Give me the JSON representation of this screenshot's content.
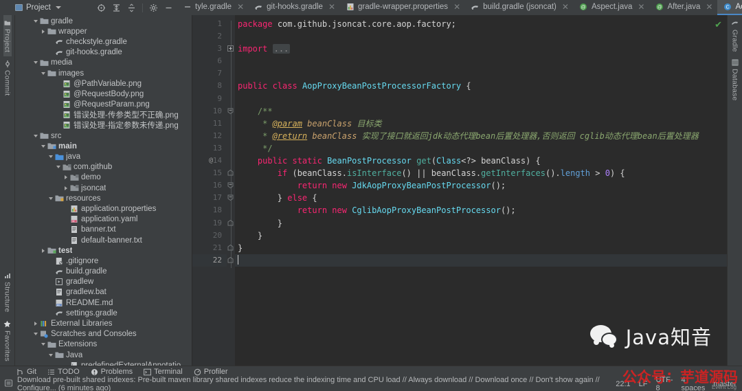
{
  "window": {
    "project_panel_title": "Project"
  },
  "project_toolbar": [
    {
      "name": "locate-file-icon",
      "title": "Select Opened File"
    },
    {
      "name": "expand-all-icon",
      "title": "Expand All"
    },
    {
      "name": "collapse-all-icon",
      "title": "Collapse All"
    },
    {
      "name": "settings-gear-icon",
      "title": "Options"
    },
    {
      "name": "hide-panel-icon",
      "title": "Hide"
    }
  ],
  "left_rail": {
    "top": [
      {
        "label": "Project",
        "icon": "project-icon",
        "selected": true
      },
      {
        "label": "Commit",
        "icon": "commit-icon",
        "selected": false
      }
    ],
    "bottom": [
      {
        "label": "Structure",
        "icon": "structure-icon"
      },
      {
        "label": "Favorites",
        "icon": "star-icon"
      }
    ]
  },
  "right_rail": [
    {
      "label": "Gradle",
      "icon": "gradle-icon"
    },
    {
      "label": "Database",
      "icon": "database-icon"
    }
  ],
  "tree": [
    {
      "label": "gradle",
      "indent": 2,
      "arrow": "down",
      "icon": "folder",
      "bold": false
    },
    {
      "label": "wrapper",
      "indent": 3,
      "arrow": "right",
      "icon": "folder",
      "bold": false
    },
    {
      "label": "checkstyle.gradle",
      "indent": 4,
      "arrow": "none",
      "icon": "gradle-file",
      "bold": false
    },
    {
      "label": "git-hooks.gradle",
      "indent": 4,
      "arrow": "none",
      "icon": "gradle-file",
      "bold": false
    },
    {
      "label": "media",
      "indent": 2,
      "arrow": "down",
      "icon": "folder",
      "bold": false
    },
    {
      "label": "images",
      "indent": 3,
      "arrow": "down",
      "icon": "folder",
      "bold": false
    },
    {
      "label": "@PathVariable.png",
      "indent": 5,
      "arrow": "none",
      "icon": "image-file",
      "bold": false
    },
    {
      "label": "@RequestBody.png",
      "indent": 5,
      "arrow": "none",
      "icon": "image-file",
      "bold": false
    },
    {
      "label": "@RequestParam.png",
      "indent": 5,
      "arrow": "none",
      "icon": "image-file",
      "bold": false
    },
    {
      "label": "错误处理-传参类型不正确.png",
      "indent": 5,
      "arrow": "none",
      "icon": "image-file",
      "bold": false
    },
    {
      "label": "错误处理-指定参数未传递.png",
      "indent": 5,
      "arrow": "none",
      "icon": "image-file",
      "bold": false
    },
    {
      "label": "src",
      "indent": 2,
      "arrow": "down",
      "icon": "folder",
      "bold": false
    },
    {
      "label": "main",
      "indent": 3,
      "arrow": "down",
      "icon": "source-root",
      "bold": true
    },
    {
      "label": "java",
      "indent": 4,
      "arrow": "down",
      "icon": "java-source-root",
      "bold": false
    },
    {
      "label": "com.github",
      "indent": 5,
      "arrow": "down",
      "icon": "package",
      "bold": false
    },
    {
      "label": "demo",
      "indent": 6,
      "arrow": "right",
      "icon": "package",
      "bold": false
    },
    {
      "label": "jsoncat",
      "indent": 6,
      "arrow": "right",
      "icon": "package",
      "bold": false
    },
    {
      "label": "resources",
      "indent": 4,
      "arrow": "down",
      "icon": "resource-root",
      "bold": false
    },
    {
      "label": "application.properties",
      "indent": 6,
      "arrow": "none",
      "icon": "properties-file",
      "bold": false
    },
    {
      "label": "application.yaml",
      "indent": 6,
      "arrow": "none",
      "icon": "yaml-file",
      "bold": false
    },
    {
      "label": "banner.txt",
      "indent": 6,
      "arrow": "none",
      "icon": "text-file",
      "bold": false
    },
    {
      "label": "default-banner.txt",
      "indent": 6,
      "arrow": "none",
      "icon": "text-file",
      "bold": false
    },
    {
      "label": "test",
      "indent": 3,
      "arrow": "right",
      "icon": "test-root",
      "bold": true
    },
    {
      "label": ".gitignore",
      "indent": 4,
      "arrow": "none",
      "icon": "ignore-file",
      "bold": false
    },
    {
      "label": "build.gradle",
      "indent": 4,
      "arrow": "none",
      "icon": "gradle-file",
      "bold": false
    },
    {
      "label": "gradlew",
      "indent": 4,
      "arrow": "none",
      "icon": "script-file",
      "bold": false
    },
    {
      "label": "gradlew.bat",
      "indent": 4,
      "arrow": "none",
      "icon": "text-file",
      "bold": false
    },
    {
      "label": "README.md",
      "indent": 4,
      "arrow": "none",
      "icon": "markdown-file",
      "bold": false
    },
    {
      "label": "settings.gradle",
      "indent": 4,
      "arrow": "none",
      "icon": "gradle-file",
      "bold": false
    },
    {
      "label": "External Libraries",
      "indent": 2,
      "arrow": "right",
      "icon": "libraries",
      "bold": false
    },
    {
      "label": "Scratches and Consoles",
      "indent": 2,
      "arrow": "down",
      "icon": "scratches",
      "bold": false
    },
    {
      "label": "Extensions",
      "indent": 3,
      "arrow": "down",
      "icon": "folder",
      "bold": false
    },
    {
      "label": "Java",
      "indent": 4,
      "arrow": "down",
      "icon": "folder",
      "bold": false
    },
    {
      "label": "predefinedExternalAnnotations.json",
      "indent": 6,
      "arrow": "none",
      "icon": "json-file",
      "bold": false
    }
  ],
  "tabs": [
    {
      "label": "tyle.gradle",
      "icon": "minus-icon",
      "active": false,
      "closable": true
    },
    {
      "label": "git-hooks.gradle",
      "icon": "gradle-file",
      "active": false,
      "closable": true
    },
    {
      "label": "gradle-wrapper.properties",
      "icon": "properties-file",
      "active": false,
      "closable": true
    },
    {
      "label": "build.gradle (jsoncat)",
      "icon": "gradle-file",
      "active": false,
      "closable": true
    },
    {
      "label": "Aspect.java",
      "icon": "annotation-green",
      "active": false,
      "closable": true
    },
    {
      "label": "After.java",
      "icon": "annotation-green",
      "active": false,
      "closable": true
    },
    {
      "label": "AopProxyBeanPostProcessorFactory.java",
      "icon": "class-blue",
      "active": true,
      "closable": true
    }
  ],
  "tabs_overflow_icon": "chevron-down-icon",
  "editor": {
    "line_numbers": [
      "1",
      "2",
      "3",
      "6",
      "7",
      "8",
      "9",
      "10",
      "11",
      "12",
      "13",
      "14",
      "15",
      "16",
      "17",
      "18",
      "19",
      "20",
      "21",
      "22"
    ],
    "gutter_annotation_line": "14",
    "gutter_annotation_mark": "@",
    "current_line": "22",
    "status_ok_icon": "checkmark-icon",
    "lines": [
      {
        "n": "1",
        "html": "<span class='kw'>package</span> <span class='pln'>com.github.jsoncat.core.aop.factory;</span>"
      },
      {
        "n": "2",
        "html": ""
      },
      {
        "n": "3",
        "html": "<span class='kw'>import</span> <span class='fold-ell'>...</span>"
      },
      {
        "n": "6",
        "html": ""
      },
      {
        "n": "7",
        "html": ""
      },
      {
        "n": "8",
        "html": "<span class='kw'>public class</span> <span class='cls'>AopProxyBeanPostProcessorFactory</span> <span class='pln'>{</span>"
      },
      {
        "n": "9",
        "html": ""
      },
      {
        "n": "10",
        "html": "    <span class='cm'>/**</span>"
      },
      {
        "n": "11",
        "html": "     <span class='cm'>* </span><span class='cmtag'>@param</span><span class='cm'> </span><span class='cmparam'>beanClass</span><span class='cm'> </span><span class='cmit'>目标类</span>"
      },
      {
        "n": "12",
        "html": "     <span class='cm'>* </span><span class='cmtag'>@return</span><span class='cm'> </span><span class='cmparam'>beanClass</span><span class='cm'> </span><span class='cmit'>实现了接口就返回jdk动态代理bean后置处理器,否则返回 cglib动态代理bean后置处理器</span>"
      },
      {
        "n": "13",
        "html": "     <span class='cm'>*/</span>"
      },
      {
        "n": "14",
        "html": "    <span class='kw'>public static</span> <span class='cls'>BeanPostProcessor</span> <span class='mth'>get</span><span class='pln'>(</span><span class='cls'>Class</span><span class='pln'>&lt;?&gt; beanClass) {</span>"
      },
      {
        "n": "15",
        "html": "        <span class='kw'>if</span> <span class='pln'>(beanClass.</span><span class='mth'>isInterface</span><span class='pln'>() || beanClass.</span><span class='mth'>getInterfaces</span><span class='pln'>().</span><span class='fld'>length</span><span class='pln'> &gt; </span><span class='num'>0</span><span class='pln'>) {</span>"
      },
      {
        "n": "16",
        "html": "            <span class='kw'>return new</span> <span class='cls'>JdkAopProxyBeanPostProcessor</span><span class='pln'>();</span>"
      },
      {
        "n": "17",
        "html": "        <span class='pln'>} </span><span class='kw'>else</span><span class='pln'> {</span>"
      },
      {
        "n": "18",
        "html": "            <span class='kw'>return new</span> <span class='cls'>CglibAopProxyBeanPostProcessor</span><span class='pln'>();</span>"
      },
      {
        "n": "19",
        "html": "        <span class='pln'>}</span>"
      },
      {
        "n": "20",
        "html": "    <span class='pln'>}</span>"
      },
      {
        "n": "21",
        "html": "<span class='pln'>}</span>"
      },
      {
        "n": "22",
        "html": "<span class='cursor'></span>"
      }
    ]
  },
  "tool_windows": [
    {
      "label": "Git",
      "icon": "git-icon"
    },
    {
      "label": "TODO",
      "icon": "todo-icon"
    },
    {
      "label": "Problems",
      "icon": "problems-icon"
    },
    {
      "label": "Terminal",
      "icon": "terminal-icon"
    },
    {
      "label": "Profiler",
      "icon": "profiler-icon"
    }
  ],
  "status_bar": {
    "notification_icon": "event-log-icon",
    "message": "Download pre-built shared indexes: Pre-built maven library shared indexes reduce the indexing time and CPU load // Always download // Download once // Don't show again // Configure... (6 minutes ago)",
    "caret_position": "22:1",
    "line_separator": "LF",
    "encoding": "UTF-8",
    "indent": "4 spaces",
    "branch": "master",
    "event_log_label": "Event Log"
  },
  "watermark": {
    "brand": "Java知音",
    "red_text": "公众号：芋道源码"
  },
  "colors": {
    "accent_blue": "#4a88c7",
    "keyword_pink": "#f92672",
    "class_cyan": "#66d9ef",
    "comment_green": "#7c9e6a",
    "editor_bg": "#2b2b2b",
    "panel_bg": "#3c3f41"
  }
}
